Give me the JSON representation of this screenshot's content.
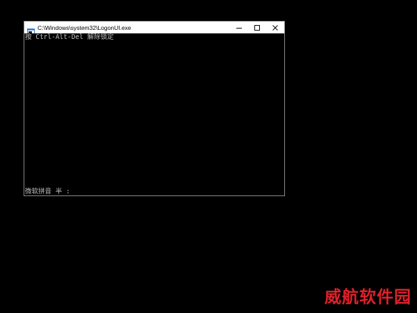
{
  "window": {
    "title": "C:\\Windows\\system32\\LogonUI.exe",
    "controls": {
      "minimize": "minimize-icon",
      "maximize": "maximize-icon",
      "close": "close-icon"
    }
  },
  "console": {
    "line1": "按 Ctrl-Alt-Del 解除锁定",
    "status": "微软拼音 半 :"
  },
  "watermark": {
    "text": "威航软件园",
    "color": "#e0202a"
  },
  "colors": {
    "background": "#000000",
    "titlebar": "#ffffff",
    "console_text": "#c0c0c0",
    "border": "#8a8a8a"
  }
}
